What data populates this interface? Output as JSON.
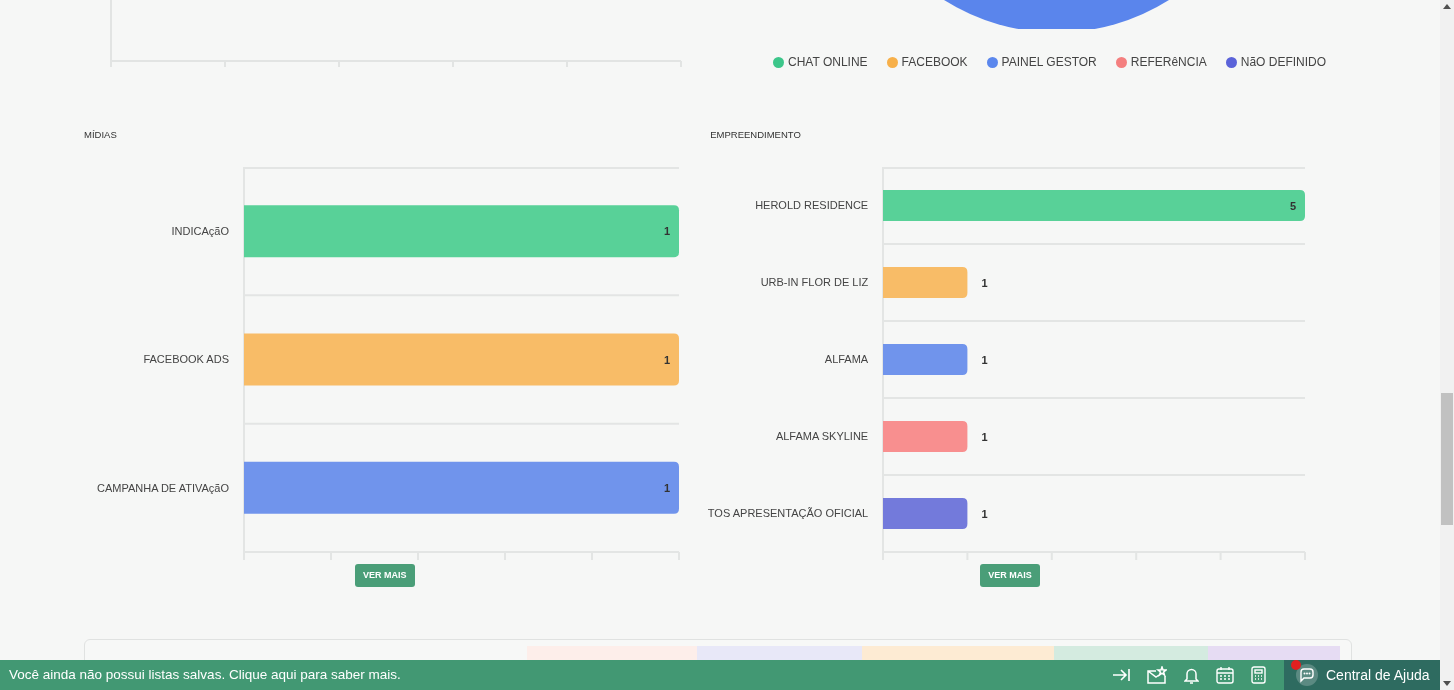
{
  "pie_legend": [
    {
      "label": "CHAT ONLINE",
      "color": "#3cc68a"
    },
    {
      "label": "FACEBOOK",
      "color": "#f7b04a"
    },
    {
      "label": "PAINEL GESTOR",
      "color": "#5b87ed"
    },
    {
      "label": "REFERêNCIA",
      "color": "#f47f7f"
    },
    {
      "label": "NãO DEFINIDO",
      "color": "#5b63d9"
    }
  ],
  "charts": [
    {
      "title": "MÍDIAS",
      "button": "VER MAIS",
      "chart_data": {
        "type": "bar",
        "orientation": "horizontal",
        "categories": [
          "INDICAçãO",
          "FACEBOOK ADS",
          "CAMPANHA DE ATIVAçãO"
        ],
        "data_labels": true,
        "colors": [
          "#58d198",
          "#f8bc67",
          "#7094ec"
        ],
        "series": [
          {
            "values": [
              1,
              1,
              1
            ]
          }
        ]
      }
    },
    {
      "title": "EMPREENDIMENTO",
      "button": "VER MAIS",
      "chart_data": {
        "type": "bar",
        "orientation": "horizontal",
        "categories": [
          "HEROLD RESIDENCE",
          "URB-IN FLOR DE LIZ",
          "ALFAMA",
          "ALFAMA SKYLINE",
          "TOS APRESENTAÇÃO OFICIAL"
        ],
        "data_labels": true,
        "colors": [
          "#58d198",
          "#f8bc67",
          "#7094ec",
          "#f88f8f",
          "#737adb"
        ],
        "series": [
          {
            "values": [
              5,
              1,
              1,
              1,
              1
            ]
          }
        ]
      }
    }
  ],
  "footer": {
    "message": "Você ainda não possui listas salvas. Clique aqui para saber mais.",
    "help": "Central de Ajuda"
  }
}
